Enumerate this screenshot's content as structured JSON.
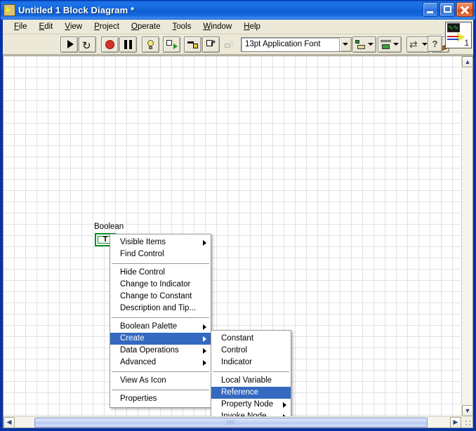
{
  "window": {
    "title": "Untitled 1 Block Diagram *",
    "icon": "labview-vi-icon",
    "minimize_label": "",
    "maximize_label": "",
    "close_label": ""
  },
  "menubar": {
    "items": [
      {
        "label": "File",
        "mnemonic": "F"
      },
      {
        "label": "Edit",
        "mnemonic": "E"
      },
      {
        "label": "View",
        "mnemonic": "V"
      },
      {
        "label": "Project",
        "mnemonic": "P"
      },
      {
        "label": "Operate",
        "mnemonic": "O"
      },
      {
        "label": "Tools",
        "mnemonic": "T"
      },
      {
        "label": "Window",
        "mnemonic": "W"
      },
      {
        "label": "Help",
        "mnemonic": "H"
      }
    ]
  },
  "toolbar": {
    "run": "run-arrow-icon",
    "run_continuously": "run-continuously-icon",
    "abort": "abort-execution-icon",
    "pause": "pause-icon",
    "highlight": "highlight-execution-icon",
    "retain_wire_values": "retain-wire-values-icon",
    "step_into": "step-into-icon",
    "step_over": "step-over-icon",
    "step_out": "step-out-icon",
    "font_value": "13pt Application Font",
    "align_objects": "align-objects-icon",
    "distribute_objects": "distribute-objects-icon",
    "reorder": "reorder-icon",
    "clean_up_diagram": "clean-up-diagram-icon",
    "help": "?",
    "vi_icon_number": "1"
  },
  "diagram": {
    "terminal_label": "Boolean",
    "terminal_glyph": "T"
  },
  "context_menu": {
    "groups": [
      {
        "items": [
          {
            "label": "Visible Items",
            "submenu": true
          },
          {
            "label": "Find Control",
            "submenu": false
          }
        ]
      },
      {
        "items": [
          {
            "label": "Hide Control",
            "submenu": false
          },
          {
            "label": "Change to Indicator",
            "submenu": false
          },
          {
            "label": "Change to Constant",
            "submenu": false
          },
          {
            "label": "Description and Tip...",
            "submenu": false
          }
        ]
      },
      {
        "items": [
          {
            "label": "Boolean Palette",
            "submenu": true
          },
          {
            "label": "Create",
            "submenu": true,
            "selected": true
          },
          {
            "label": "Data Operations",
            "submenu": true
          },
          {
            "label": "Advanced",
            "submenu": true
          }
        ]
      },
      {
        "items": [
          {
            "label": "View As Icon",
            "submenu": false
          }
        ]
      },
      {
        "items": [
          {
            "label": "Properties",
            "submenu": false
          }
        ]
      }
    ]
  },
  "create_submenu": {
    "groups": [
      {
        "items": [
          {
            "label": "Constant",
            "submenu": false
          },
          {
            "label": "Control",
            "submenu": false
          },
          {
            "label": "Indicator",
            "submenu": false
          }
        ]
      },
      {
        "items": [
          {
            "label": "Local Variable",
            "submenu": false
          },
          {
            "label": "Reference",
            "submenu": false,
            "selected": true
          },
          {
            "label": "Property Node",
            "submenu": true
          },
          {
            "label": "Invoke Node",
            "submenu": true
          }
        ]
      }
    ]
  },
  "scrollbars": {
    "v_up": "▲",
    "v_down": "▼",
    "h_left": "◀",
    "h_right": "▶"
  },
  "colors": {
    "title_blue": "#1668de",
    "menu_highlight": "#3569c0",
    "terminal_green": "#0f8a1e",
    "abort_red": "#d2342a",
    "client_bg": "#ece9d8"
  }
}
